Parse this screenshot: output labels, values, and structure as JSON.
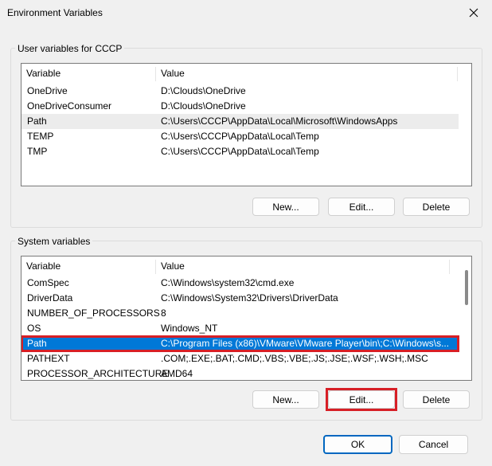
{
  "window": {
    "title": "Environment Variables"
  },
  "user_section": {
    "label": "User variables for CCCP",
    "columns": [
      "Variable",
      "Value"
    ],
    "rows": [
      {
        "name": "OneDrive",
        "value": "D:\\Clouds\\OneDrive"
      },
      {
        "name": "OneDriveConsumer",
        "value": "D:\\Clouds\\OneDrive"
      },
      {
        "name": "Path",
        "value": "C:\\Users\\CCCP\\AppData\\Local\\Microsoft\\WindowsApps"
      },
      {
        "name": "TEMP",
        "value": "C:\\Users\\CCCP\\AppData\\Local\\Temp"
      },
      {
        "name": "TMP",
        "value": "C:\\Users\\CCCP\\AppData\\Local\\Temp"
      }
    ],
    "buttons": {
      "new": "New...",
      "edit": "Edit...",
      "delete": "Delete"
    }
  },
  "system_section": {
    "label": "System variables",
    "columns": [
      "Variable",
      "Value"
    ],
    "rows": [
      {
        "name": "ComSpec",
        "value": "C:\\Windows\\system32\\cmd.exe"
      },
      {
        "name": "DriverData",
        "value": "C:\\Windows\\System32\\Drivers\\DriverData"
      },
      {
        "name": "NUMBER_OF_PROCESSORS",
        "value": "8"
      },
      {
        "name": "OS",
        "value": "Windows_NT"
      },
      {
        "name": "Path",
        "value": "C:\\Program Files (x86)\\VMware\\VMware Player\\bin\\;C:\\Windows\\s..."
      },
      {
        "name": "PATHEXT",
        "value": ".COM;.EXE;.BAT;.CMD;.VBS;.VBE;.JS;.JSE;.WSF;.WSH;.MSC"
      },
      {
        "name": "PROCESSOR_ARCHITECTURE",
        "value": "AMD64"
      }
    ],
    "buttons": {
      "new": "New...",
      "edit": "Edit...",
      "delete": "Delete"
    }
  },
  "footer": {
    "ok": "OK",
    "cancel": "Cancel"
  },
  "colors": {
    "selection": "#0078d7",
    "highlight_box": "#d71f26",
    "default_button_border": "#0067c0"
  }
}
